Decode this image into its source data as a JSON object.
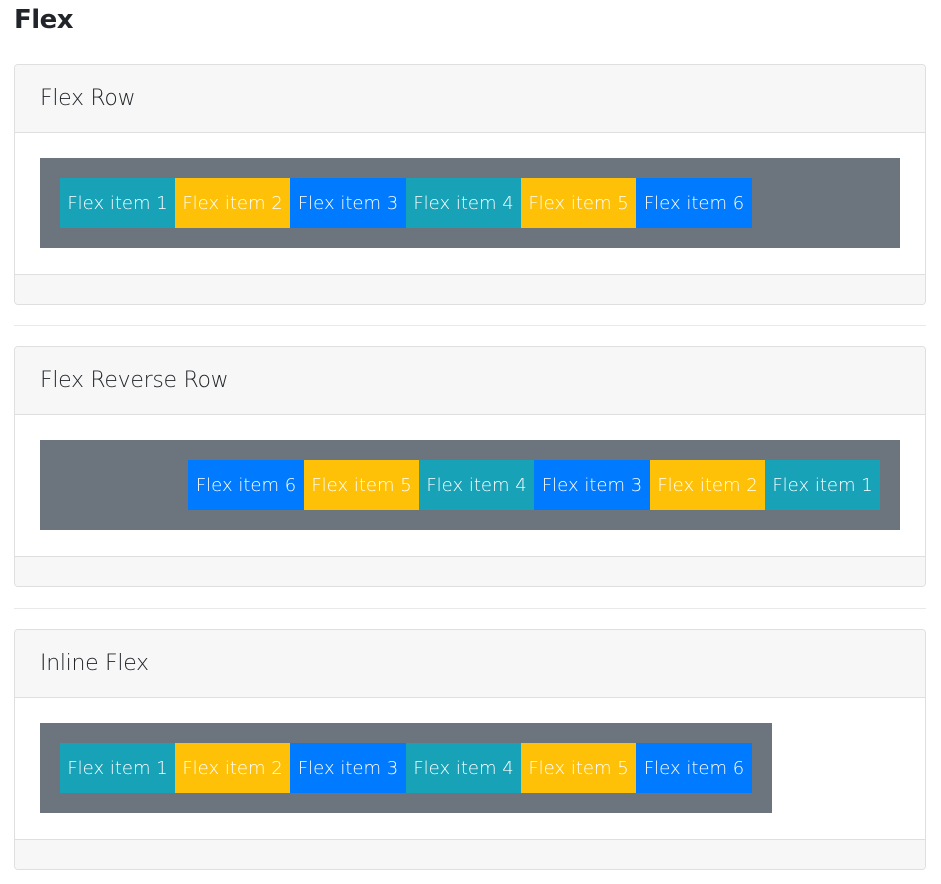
{
  "page_title": "Flex",
  "colors": {
    "teal": "#17a2b8",
    "yellow": "#ffc107",
    "blue": "#007bff",
    "gray": "#6c757d"
  },
  "sections": [
    {
      "title": "Flex Row",
      "items": [
        {
          "label": "Flex item 1",
          "color": "#17a2b8"
        },
        {
          "label": "Flex item 2",
          "color": "#ffc107"
        },
        {
          "label": "Flex item 3",
          "color": "#007bff"
        },
        {
          "label": "Flex item 4",
          "color": "#17a2b8"
        },
        {
          "label": "Flex item 5",
          "color": "#ffc107"
        },
        {
          "label": "Flex item 6",
          "color": "#007bff"
        }
      ]
    },
    {
      "title": "Flex Reverse Row",
      "items": [
        {
          "label": "Flex item 1",
          "color": "#17a2b8"
        },
        {
          "label": "Flex item 2",
          "color": "#ffc107"
        },
        {
          "label": "Flex item 3",
          "color": "#007bff"
        },
        {
          "label": "Flex item 4",
          "color": "#17a2b8"
        },
        {
          "label": "Flex item 5",
          "color": "#ffc107"
        },
        {
          "label": "Flex item 6",
          "color": "#007bff"
        }
      ]
    },
    {
      "title": "Inline Flex",
      "items": [
        {
          "label": "Flex item 1",
          "color": "#17a2b8"
        },
        {
          "label": "Flex item 2",
          "color": "#ffc107"
        },
        {
          "label": "Flex item 3",
          "color": "#007bff"
        },
        {
          "label": "Flex item 4",
          "color": "#17a2b8"
        },
        {
          "label": "Flex item 5",
          "color": "#ffc107"
        },
        {
          "label": "Flex item 6",
          "color": "#007bff"
        }
      ]
    }
  ]
}
